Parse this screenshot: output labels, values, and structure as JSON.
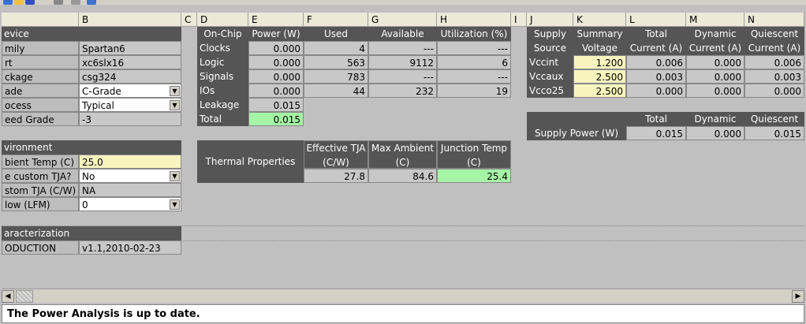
{
  "columns": [
    "B",
    "C",
    "D",
    "E",
    "F",
    "G",
    "H",
    "I",
    "J",
    "K",
    "L",
    "M",
    "N"
  ],
  "device": {
    "header": "evice",
    "rows": [
      {
        "label": "mily",
        "value": "Spartan6"
      },
      {
        "label": "rt",
        "value": "xc6slx16"
      },
      {
        "label": "ckage",
        "value": "csg324"
      },
      {
        "label": "ade",
        "value": "C-Grade"
      },
      {
        "label": "ocess",
        "value": "Typical"
      },
      {
        "label": "eed Grade",
        "value": "-3"
      }
    ]
  },
  "environment": {
    "header": "vironment",
    "rows": [
      {
        "label": "bient Temp (C)",
        "value": "25.0"
      },
      {
        "label": "e custom TJA?",
        "value": "No"
      },
      {
        "label": "stom TJA (C/W)",
        "value": "NA"
      },
      {
        "label": "low (LFM)",
        "value": "0"
      }
    ]
  },
  "characterization": {
    "header": "aracterization",
    "label": "ODUCTION",
    "value": "v1.1,2010-02-23"
  },
  "onchip": {
    "headers": [
      "On-Chip",
      "Power (W)",
      "Used",
      "Available",
      "Utilization (%)"
    ],
    "rows": [
      {
        "name": "Clocks",
        "power": "0.000",
        "used": "4",
        "avail": "---",
        "util": "---"
      },
      {
        "name": "Logic",
        "power": "0.000",
        "used": "563",
        "avail": "9112",
        "util": "6"
      },
      {
        "name": "Signals",
        "power": "0.000",
        "used": "783",
        "avail": "---",
        "util": "---"
      },
      {
        "name": "IOs",
        "power": "0.000",
        "used": "44",
        "avail": "232",
        "util": "19"
      },
      {
        "name": "Leakage",
        "power": "0.015"
      },
      {
        "name": "Total",
        "power": "0.015"
      }
    ]
  },
  "thermal": {
    "title": "Thermal  Properties",
    "headers": [
      "Effective TJA\n(C/W)",
      "Max Ambient\n(C)",
      "Junction Temp\n(C)"
    ],
    "h1": [
      "Effective TJA",
      "Max Ambient",
      "Junction Temp"
    ],
    "h2": [
      "(C/W)",
      "(C)",
      "(C)"
    ],
    "values": [
      "27.8",
      "84.6",
      "25.4"
    ]
  },
  "supply": {
    "h1": [
      "Supply",
      "Summary",
      "Total",
      "Dynamic",
      "Quiescent"
    ],
    "h2": [
      "Source",
      "Voltage",
      "Current (A)",
      "Current (A)",
      "Current (A)"
    ],
    "rows": [
      {
        "source": "Vccint",
        "voltage": "1.200",
        "total": "0.006",
        "dynamic": "0.000",
        "quiescent": "0.006"
      },
      {
        "source": "Vccaux",
        "voltage": "2.500",
        "total": "0.003",
        "dynamic": "0.000",
        "quiescent": "0.003"
      },
      {
        "source": "Vcco25",
        "voltage": "2.500",
        "total": "0.000",
        "dynamic": "0.000",
        "quiescent": "0.000"
      }
    ]
  },
  "supply_power": {
    "headers": [
      "Total",
      "Dynamic",
      "Quiescent"
    ],
    "label": "Supply  Power (W)",
    "values": [
      "0.015",
      "0.000",
      "0.015"
    ]
  },
  "status": "The Power Analysis is up to date.",
  "colors": {
    "dark": "#555555",
    "yellow": "#f8f4c0",
    "green": "#a6f5a6"
  }
}
